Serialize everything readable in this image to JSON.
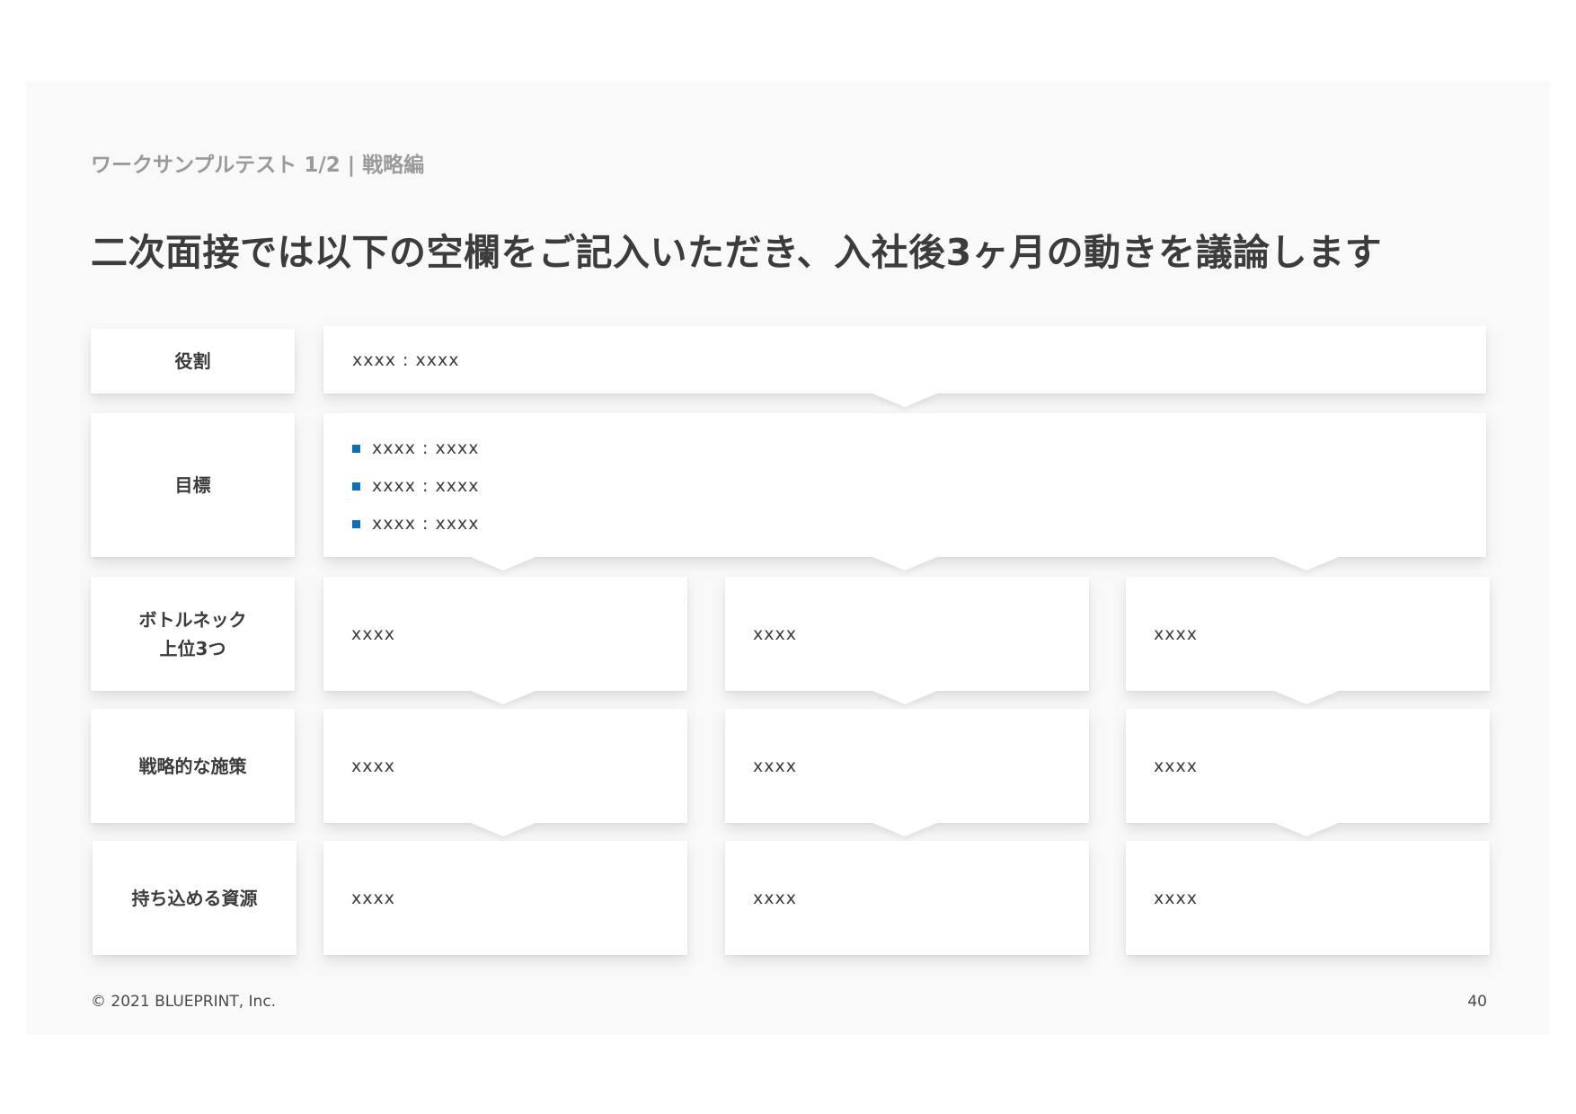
{
  "header": {
    "subtitle": "ワークサンプルテスト 1/2 | 戦略編",
    "title": "二次面接では以下の空欄をご記入いただき、入社後3ヶ月の動きを議論します"
  },
  "rows": {
    "role": {
      "label": "役割",
      "value": "xxxx : xxxx"
    },
    "goals": {
      "label": "目標",
      "items": [
        "xxxx : xxxx",
        "xxxx : xxxx",
        "xxxx : xxxx"
      ]
    },
    "bottlenecks": {
      "label_line1": "ボトルネック",
      "label_line2": "上位3つ",
      "cells": [
        "xxxx",
        "xxxx",
        "xxxx"
      ]
    },
    "strategies": {
      "label": "戦略的な施策",
      "cells": [
        "xxxx",
        "xxxx",
        "xxxx"
      ]
    },
    "resources": {
      "label": "持ち込める資源",
      "cells": [
        "xxxx",
        "xxxx",
        "xxxx"
      ]
    }
  },
  "footer": {
    "copyright": "© 2021 BLUEPRINT, Inc.",
    "page_number": "40"
  },
  "colors": {
    "bullet": "#0a6fb8",
    "title": "#3c3c3c",
    "subtitle": "#9a9a9a"
  }
}
